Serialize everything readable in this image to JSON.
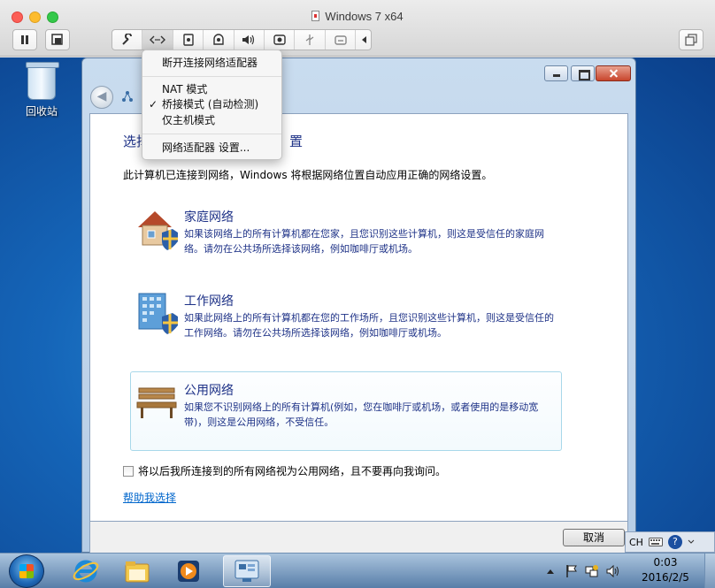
{
  "window": {
    "title": "Windows 7 x64"
  },
  "toolbar": {
    "pause": "pause-icon",
    "snapshot": "snapshot-icon",
    "devices": [
      "wrench-icon",
      "network-icon",
      "harddisk-icon",
      "camera-icon",
      "sound-icon",
      "webcam-icon",
      "usb-icon",
      "share-icon",
      "arrow-left-icon"
    ],
    "fullscreen": "fullscreen-icon"
  },
  "network_menu": {
    "disconnect": "断开连接网络适配器",
    "nat": "NAT 模式",
    "bridged": "桥接模式 (自动检测)",
    "host_only": "仅主机模式",
    "settings": "网络适配器 设置...",
    "checked_mark": "✓"
  },
  "desktop": {
    "recycle_bin": "回收站"
  },
  "dialog": {
    "heading_left": "选择",
    "heading_right": "置",
    "intro": "此计算机已连接到网络，Windows 将根据网络位置自动应用正确的网络设置。",
    "options": [
      {
        "title": "家庭网络",
        "desc": "如果该网络上的所有计算机都在您家，且您识别这些计算机，则这是受信任的家庭网络。请勿在公共场所选择该网络，例如咖啡厅或机场。"
      },
      {
        "title": "工作网络",
        "desc": "如果此网络上的所有计算机都在您的工作场所，且您识别这些计算机，则这是受信任的工作网络。请勿在公共场所选择该网络，例如咖啡厅或机场。"
      },
      {
        "title": "公用网络",
        "desc": "如果您不识别网络上的所有计算机(例如，您在咖啡厅或机场，或者使用的是移动宽带)，则这是公用网络，不受信任。"
      }
    ],
    "checkbox_label": "将以后我所连接到的所有网络视为公用网络，且不要再向我询问。",
    "help_link": "帮助我选择",
    "cancel": "取消"
  },
  "langbar": {
    "lang": "CH",
    "help": "?"
  },
  "taskbar": {
    "apps": [
      "ie-icon",
      "explorer-icon",
      "media-player-icon",
      "network-location-icon"
    ],
    "clock_time": "0:03",
    "clock_date": "2016/2/5"
  }
}
